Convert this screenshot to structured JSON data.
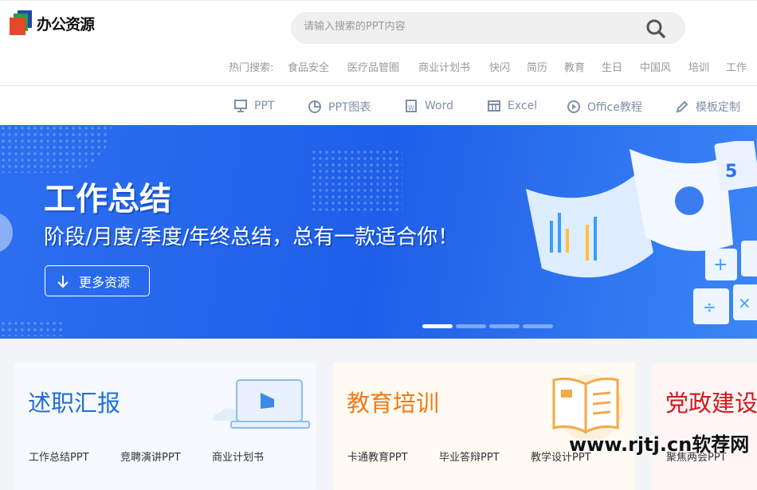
{
  "header": {
    "logo_text": "办公资源",
    "search_placeholder": "请输入搜索的PPT内容",
    "hot_label": "热门搜索:",
    "hot_items": [
      "食品安全",
      "医疗品管圈",
      "商业计划书",
      "快闪",
      "简历",
      "教育",
      "生日",
      "中国风",
      "培训",
      "工作"
    ]
  },
  "nav": {
    "items": [
      {
        "label": "PPT",
        "icon": "presentation-icon"
      },
      {
        "label": "PPT图表",
        "icon": "pie-chart-icon"
      },
      {
        "label": "Word",
        "icon": "word-doc-icon"
      },
      {
        "label": "Excel",
        "icon": "spreadsheet-icon"
      },
      {
        "label": "Office教程",
        "icon": "play-circle-icon"
      },
      {
        "label": "模板定制",
        "icon": "pen-icon"
      }
    ]
  },
  "banner": {
    "title": "工作总结",
    "subtitle": "阶段/月度/季度/年终总结，总有一款适合你！",
    "button_label": "更多资源",
    "slides": 4,
    "active_slide": 1
  },
  "cards": [
    {
      "title": "述职汇报",
      "color": "#1f6fd6",
      "bg": "#f6f9fe",
      "links": [
        "工作总结PPT",
        "竞聘演讲PPT",
        "商业计划书"
      ]
    },
    {
      "title": "教育培训",
      "color": "#f07a1a",
      "bg": "#fffbf3",
      "links": [
        "卡通教育PPT",
        "毕业答辩PPT",
        "教学设计PPT"
      ]
    },
    {
      "title": "党政建设",
      "color": "#d0181d",
      "bg": "#fff5f5",
      "links": [
        "聚焦两会PPT"
      ]
    }
  ],
  "watermark": "www.rjtj.cn软荐网"
}
